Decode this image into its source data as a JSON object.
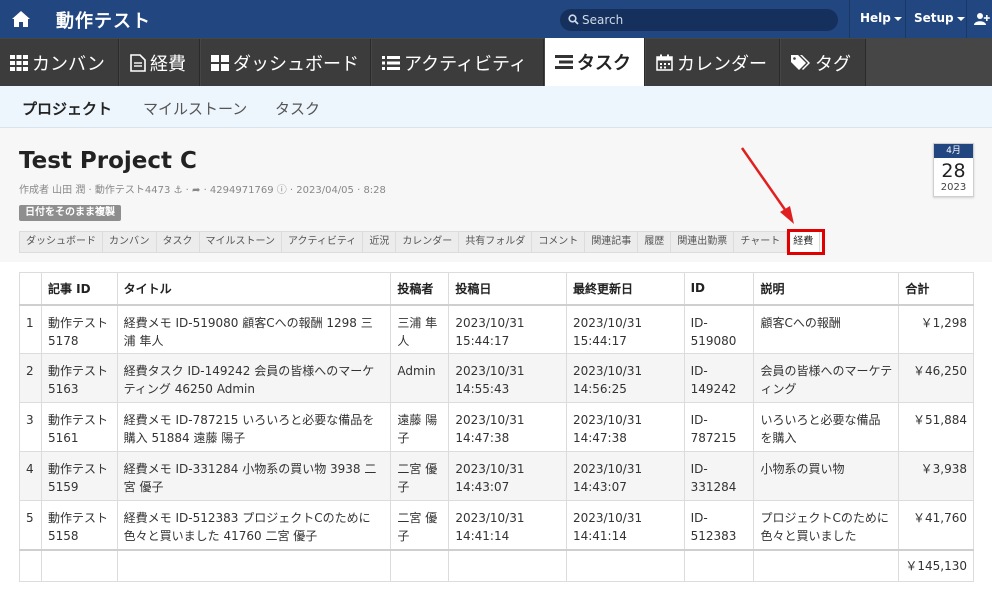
{
  "topbar": {
    "title": "動作テスト",
    "search_placeholder": "Search",
    "help_label": "Help",
    "setup_label": "Setup"
  },
  "mainnav": {
    "tabs": [
      {
        "label": "カンバン",
        "icon": "grid-icon"
      },
      {
        "label": "経費",
        "icon": "document-icon"
      },
      {
        "label": "ダッシュボード",
        "icon": "dashboard-icon"
      },
      {
        "label": "アクティビティ",
        "icon": "list-icon"
      },
      {
        "label": "タスク",
        "icon": "tasks-icon",
        "active": true
      },
      {
        "label": "カレンダー",
        "icon": "calendar-icon"
      },
      {
        "label": "タグ",
        "icon": "tag-icon"
      }
    ]
  },
  "subnav": {
    "items": [
      "プロジェクト",
      "マイルストーン",
      "タスク"
    ]
  },
  "project": {
    "title": "Test Project C",
    "meta": "作成者 山田 潤 · 動作テスト4473 ⚓ · ➦ · 4294971769 ⓘ · 2023/04/05 · 8:28",
    "copy_button": "日付をそのまま複製",
    "calendar": {
      "month": "4月",
      "day": "28",
      "year": "2023"
    }
  },
  "project_tabs": [
    "ダッシュボード",
    "カンバン",
    "タスク",
    "マイルストーン",
    "アクティビティ",
    "近況",
    "カレンダー",
    "共有フォルダ",
    "コメント",
    "関連記事",
    "履歴",
    "関連出勤票",
    "チャート",
    "経費"
  ],
  "table": {
    "headers": [
      "",
      "記事 ID",
      "タイトル",
      "投稿者",
      "投稿日",
      "最終更新日",
      "ID",
      "説明",
      "合計"
    ],
    "rows": [
      {
        "n": "1",
        "article_id": "動作テスト5178",
        "title": "経費メモ ID-519080 顧客Cへの報酬 1298 三浦 隼人",
        "author": "三浦 隼人",
        "posted": "2023/10/31 15:44:17",
        "updated": "2023/10/31 15:44:17",
        "id": "ID-519080",
        "desc": "顧客Cへの報酬",
        "total": "￥1,298"
      },
      {
        "n": "2",
        "article_id": "動作テスト5163",
        "title": "経費タスク ID-149242 会員の皆様へのマーケティング 46250 Admin",
        "author": "Admin",
        "posted": "2023/10/31 14:55:43",
        "updated": "2023/10/31 14:56:25",
        "id": "ID-149242",
        "desc": "会員の皆様へのマーケティング",
        "total": "￥46,250"
      },
      {
        "n": "3",
        "article_id": "動作テスト5161",
        "title": "経費メモ ID-787215 いろいろと必要な備品を購入 51884 遠藤 陽子",
        "author": "遠藤 陽子",
        "posted": "2023/10/31 14:47:38",
        "updated": "2023/10/31 14:47:38",
        "id": "ID-787215",
        "desc": "いろいろと必要な備品を購入",
        "total": "￥51,884"
      },
      {
        "n": "4",
        "article_id": "動作テスト5159",
        "title": "経費メモ ID-331284 小物系の買い物 3938 二宮 優子",
        "author": "二宮 優子",
        "posted": "2023/10/31 14:43:07",
        "updated": "2023/10/31 14:43:07",
        "id": "ID-331284",
        "desc": "小物系の買い物",
        "total": "￥3,938"
      },
      {
        "n": "5",
        "article_id": "動作テスト5158",
        "title": "経費メモ ID-512383 プロジェクトCのために色々と買いました 41760 二宮 優子",
        "author": "二宮 優子",
        "posted": "2023/10/31 14:41:14",
        "updated": "2023/10/31 14:41:14",
        "id": "ID-512383",
        "desc": "プロジェクトCのために色々と買いました",
        "total": "￥41,760"
      }
    ],
    "grand_total": "￥145,130"
  }
}
